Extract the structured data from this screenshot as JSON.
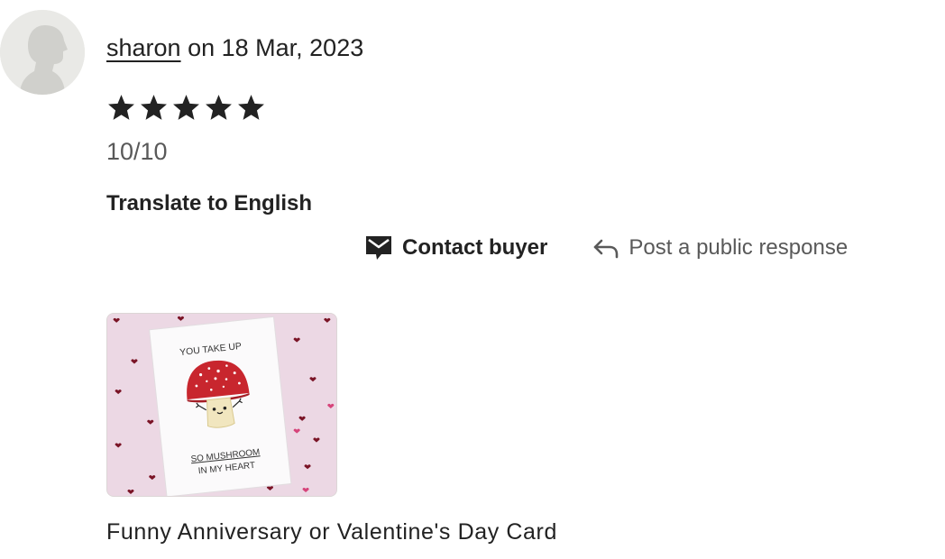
{
  "review": {
    "reviewer_name": "sharon",
    "date_text": "on 18 Mar, 2023",
    "rating": 5,
    "rating_max": 5,
    "text": "10/10",
    "translate_label": "Translate to English"
  },
  "actions": {
    "contact_label": "Contact buyer",
    "response_label": "Post a public response"
  },
  "listing": {
    "title": "Funny Anniversary or Valentine's Day Card",
    "card_text_top": "YOU TAKE UP",
    "card_text_line1": "SO MUSHROOM",
    "card_text_line2": "IN MY HEART"
  },
  "colors": {
    "text_primary": "#222222",
    "text_secondary": "#595959",
    "card_background": "#ecd8e4",
    "mushroom_cap": "#c8262e"
  },
  "icons": {
    "avatar": "default-avatar-silhouette",
    "star": "star-icon",
    "contact": "message-icon",
    "response": "reply-arrow-icon"
  }
}
